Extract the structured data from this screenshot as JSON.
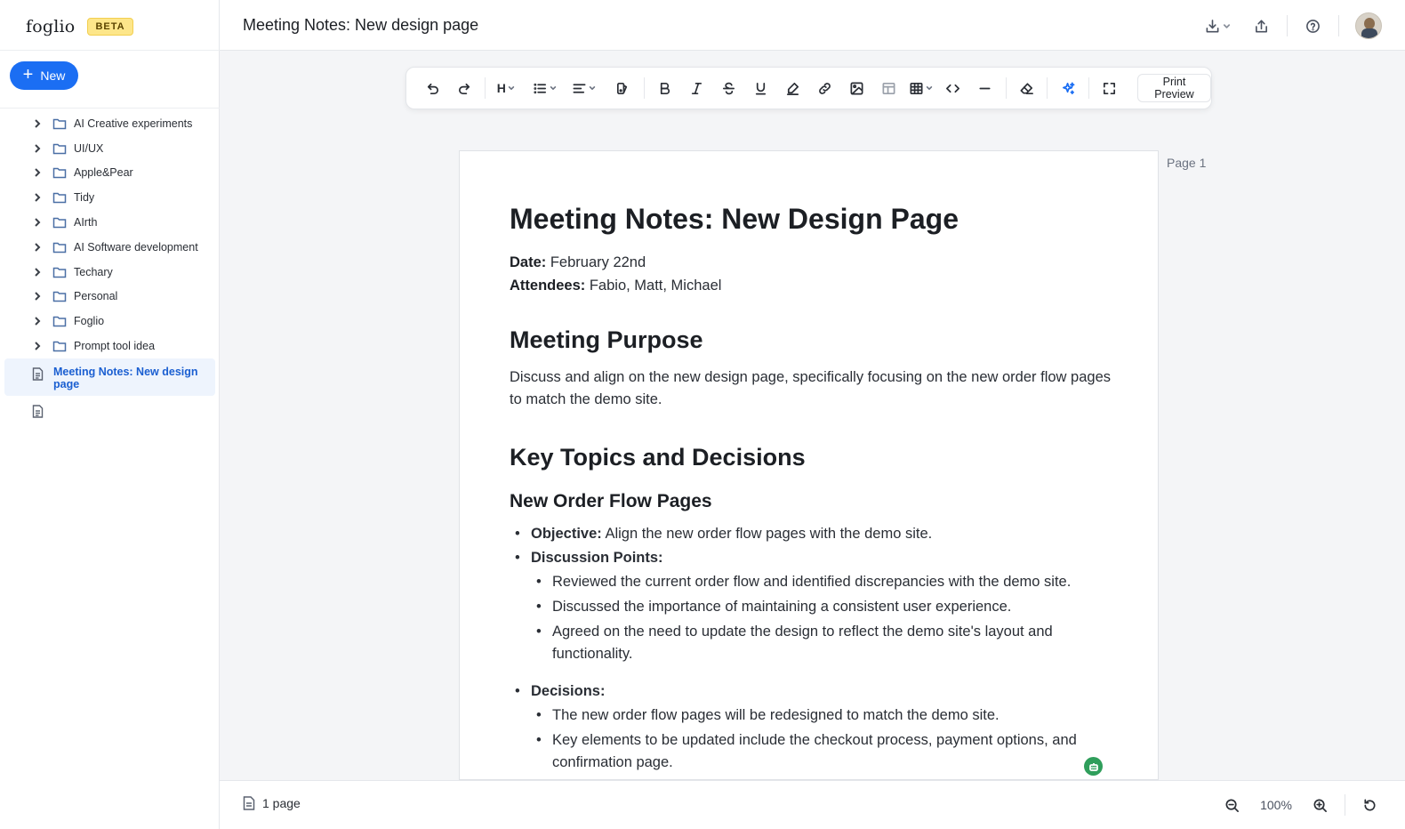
{
  "brand": {
    "name": "foglio",
    "badge": "BETA"
  },
  "sidebar": {
    "new_label": "New",
    "folders": [
      "AI Creative experiments",
      "UI/UX",
      "Apple&Pear",
      "Tidy",
      "AIrth",
      "AI Software development",
      "Techary",
      "Personal",
      "Foglio",
      "Prompt tool idea"
    ],
    "active_doc": "Meeting Notes: New design page",
    "untitled_doc": ""
  },
  "header": {
    "title": "Meeting Notes: New design page"
  },
  "toolbar": {
    "heading_label": "H",
    "print_label": "Print Preview"
  },
  "page": {
    "label": "Page 1"
  },
  "document": {
    "title": "Meeting Notes: New Design Page",
    "date_label": "Date:",
    "date_value": " February 22nd",
    "attendees_label": "Attendees:",
    "attendees_value": " Fabio, Matt, Michael",
    "purpose_heading": "Meeting Purpose",
    "purpose_text": "Discuss and align on the new design page, specifically focusing on the new order flow pages to match the demo site.",
    "topics_heading": "Key Topics and Decisions",
    "subsection_heading": "New Order Flow Pages",
    "objective_label": "Objective:",
    "objective_text": " Align the new order flow pages with the demo site.",
    "discussion_label": "Discussion Points:",
    "discussion_points": [
      "Reviewed the current order flow and identified discrepancies with the demo site.",
      "Discussed the importance of maintaining a consistent user experience.",
      "Agreed on the need to update the design to reflect the demo site's layout and functionality."
    ],
    "decisions_label": "Decisions:",
    "decisions": [
      "The new order flow pages will be redesigned to match the demo site.",
      "Key elements to be updated include the checkout process, payment options, and confirmation page."
    ]
  },
  "footer": {
    "pages_count": "1 page",
    "zoom": "100%"
  },
  "colors": {
    "accent": "#1b6ef3",
    "beta_bg": "#fde68a",
    "bot_badge": "#2f9e5b"
  }
}
